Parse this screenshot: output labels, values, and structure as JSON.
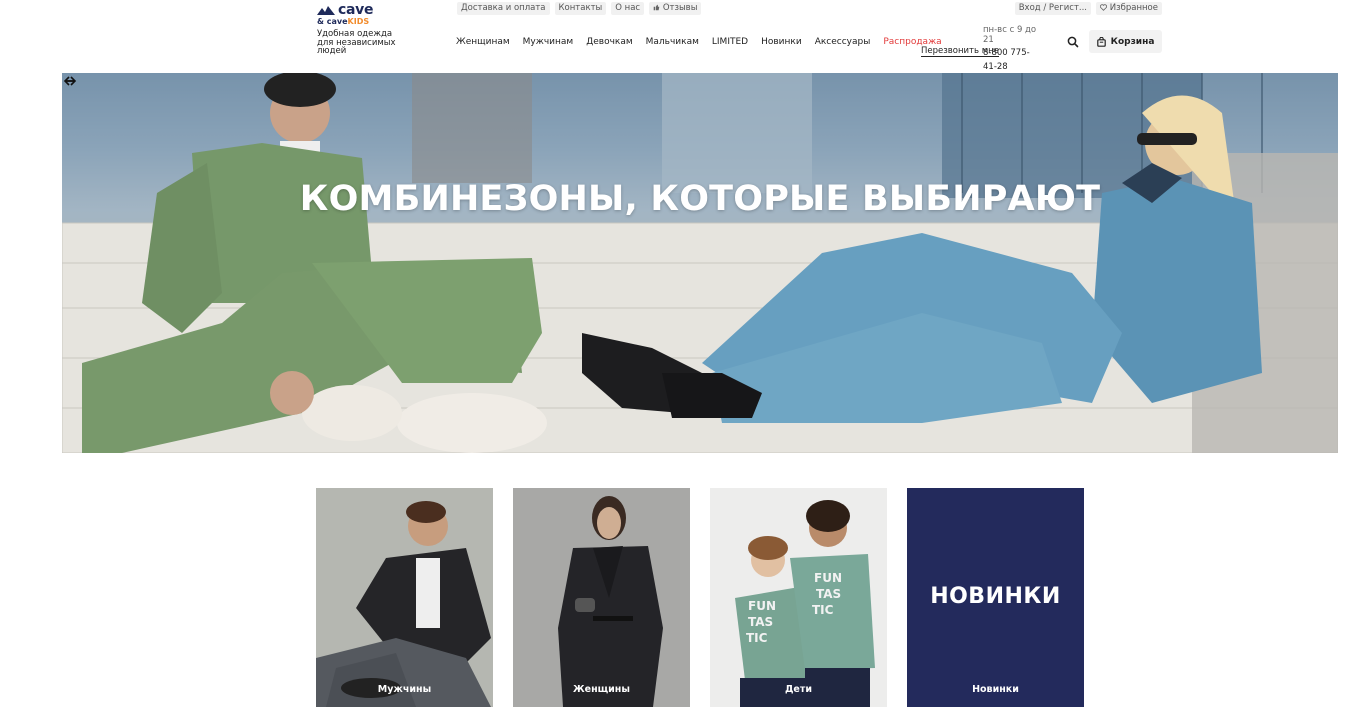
{
  "brand": {
    "name": "cave",
    "sub_prefix": "& cave",
    "sub_kids": "KIDS",
    "tagline": "Удобная одежда для независимых людей"
  },
  "topnav": {
    "items": [
      "Доставка и оплата",
      "Контакты",
      "О нас",
      "Отзывы"
    ]
  },
  "account": {
    "login": "Вход / Регист...",
    "favorites": "Избранное"
  },
  "mainnav": {
    "items": [
      "Женщинам",
      "Мужчинам",
      "Девочкам",
      "Мальчикам",
      "LIMITED",
      "Новинки",
      "Аксессуары"
    ],
    "sale": "Распродажа"
  },
  "contacts": {
    "hours": "пн-вс с 9 до 21",
    "callback": "Перезвонить мне",
    "phone": "8-800 775-41-28"
  },
  "cart": {
    "label": "Корзина"
  },
  "hero": {
    "title": "КОМБИНЕЗОНЫ, КОТОРЫЕ ВЫБИРАЮТ"
  },
  "categories": [
    {
      "label": "Мужчины"
    },
    {
      "label": "Женщины"
    },
    {
      "label": "Дети"
    },
    {
      "label": "Новинки",
      "title": "НОВИНКИ"
    }
  ],
  "colors": {
    "brand_navy": "#1e2a5a",
    "kids_orange": "#f28b2b",
    "sale_red": "#e23b3b",
    "tile_navy": "#232a5c"
  }
}
